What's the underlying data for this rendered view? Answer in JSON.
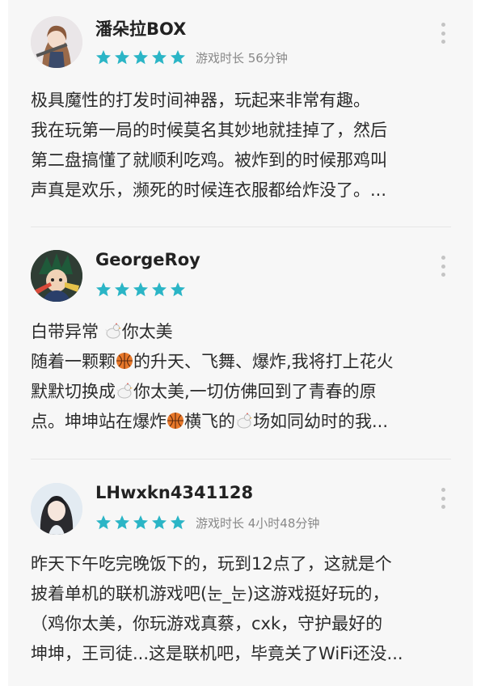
{
  "colors": {
    "star": "#2bb5c6",
    "dots": "#c4c4c4"
  },
  "reviews": [
    {
      "username": "潘朵拉BOX",
      "rating": 5,
      "playtime": "游戏时长 56分钟",
      "lines": [
        "极具魔性的打发时间神器，玩起来非常有趣。",
        "我在玩第一局的时候莫名其妙地就挂掉了，然后",
        "第二盘搞懂了就顺利吃鸡。被炸到的时候那鸡叫",
        "声真是欢乐，濒死的时候连衣服都给炸没了。..."
      ]
    },
    {
      "username": "GeorgeRoy",
      "rating": 5,
      "line1": {
        "a": "白带异常 ",
        "b": "你太美"
      },
      "line2": {
        "a": "随着一颗颗",
        "b": "的升天、飞舞、爆炸,我将打上花火"
      },
      "line3": {
        "a": "默默切换成",
        "b": "你太美,一切仿佛回到了青春的原"
      },
      "line4": {
        "a": "点。坤坤站在爆炸",
        "b": "横飞的",
        "c": "场如同幼时的我..."
      }
    },
    {
      "username": "LHwxkn4341128",
      "rating": 5,
      "playtime": "游戏时长 4小时48分钟",
      "lines": [
        "昨天下午吃完晚饭下的，玩到12点了，这就是个",
        "披着单机的联机游戏吧(눈_눈)这游戏挺好玩的，",
        "（鸡你太美，你玩游戏真蔡，cxk，守护最好的",
        "坤坤，王司徒...这是联机吧，毕竟关了WiFi还没..."
      ]
    }
  ]
}
